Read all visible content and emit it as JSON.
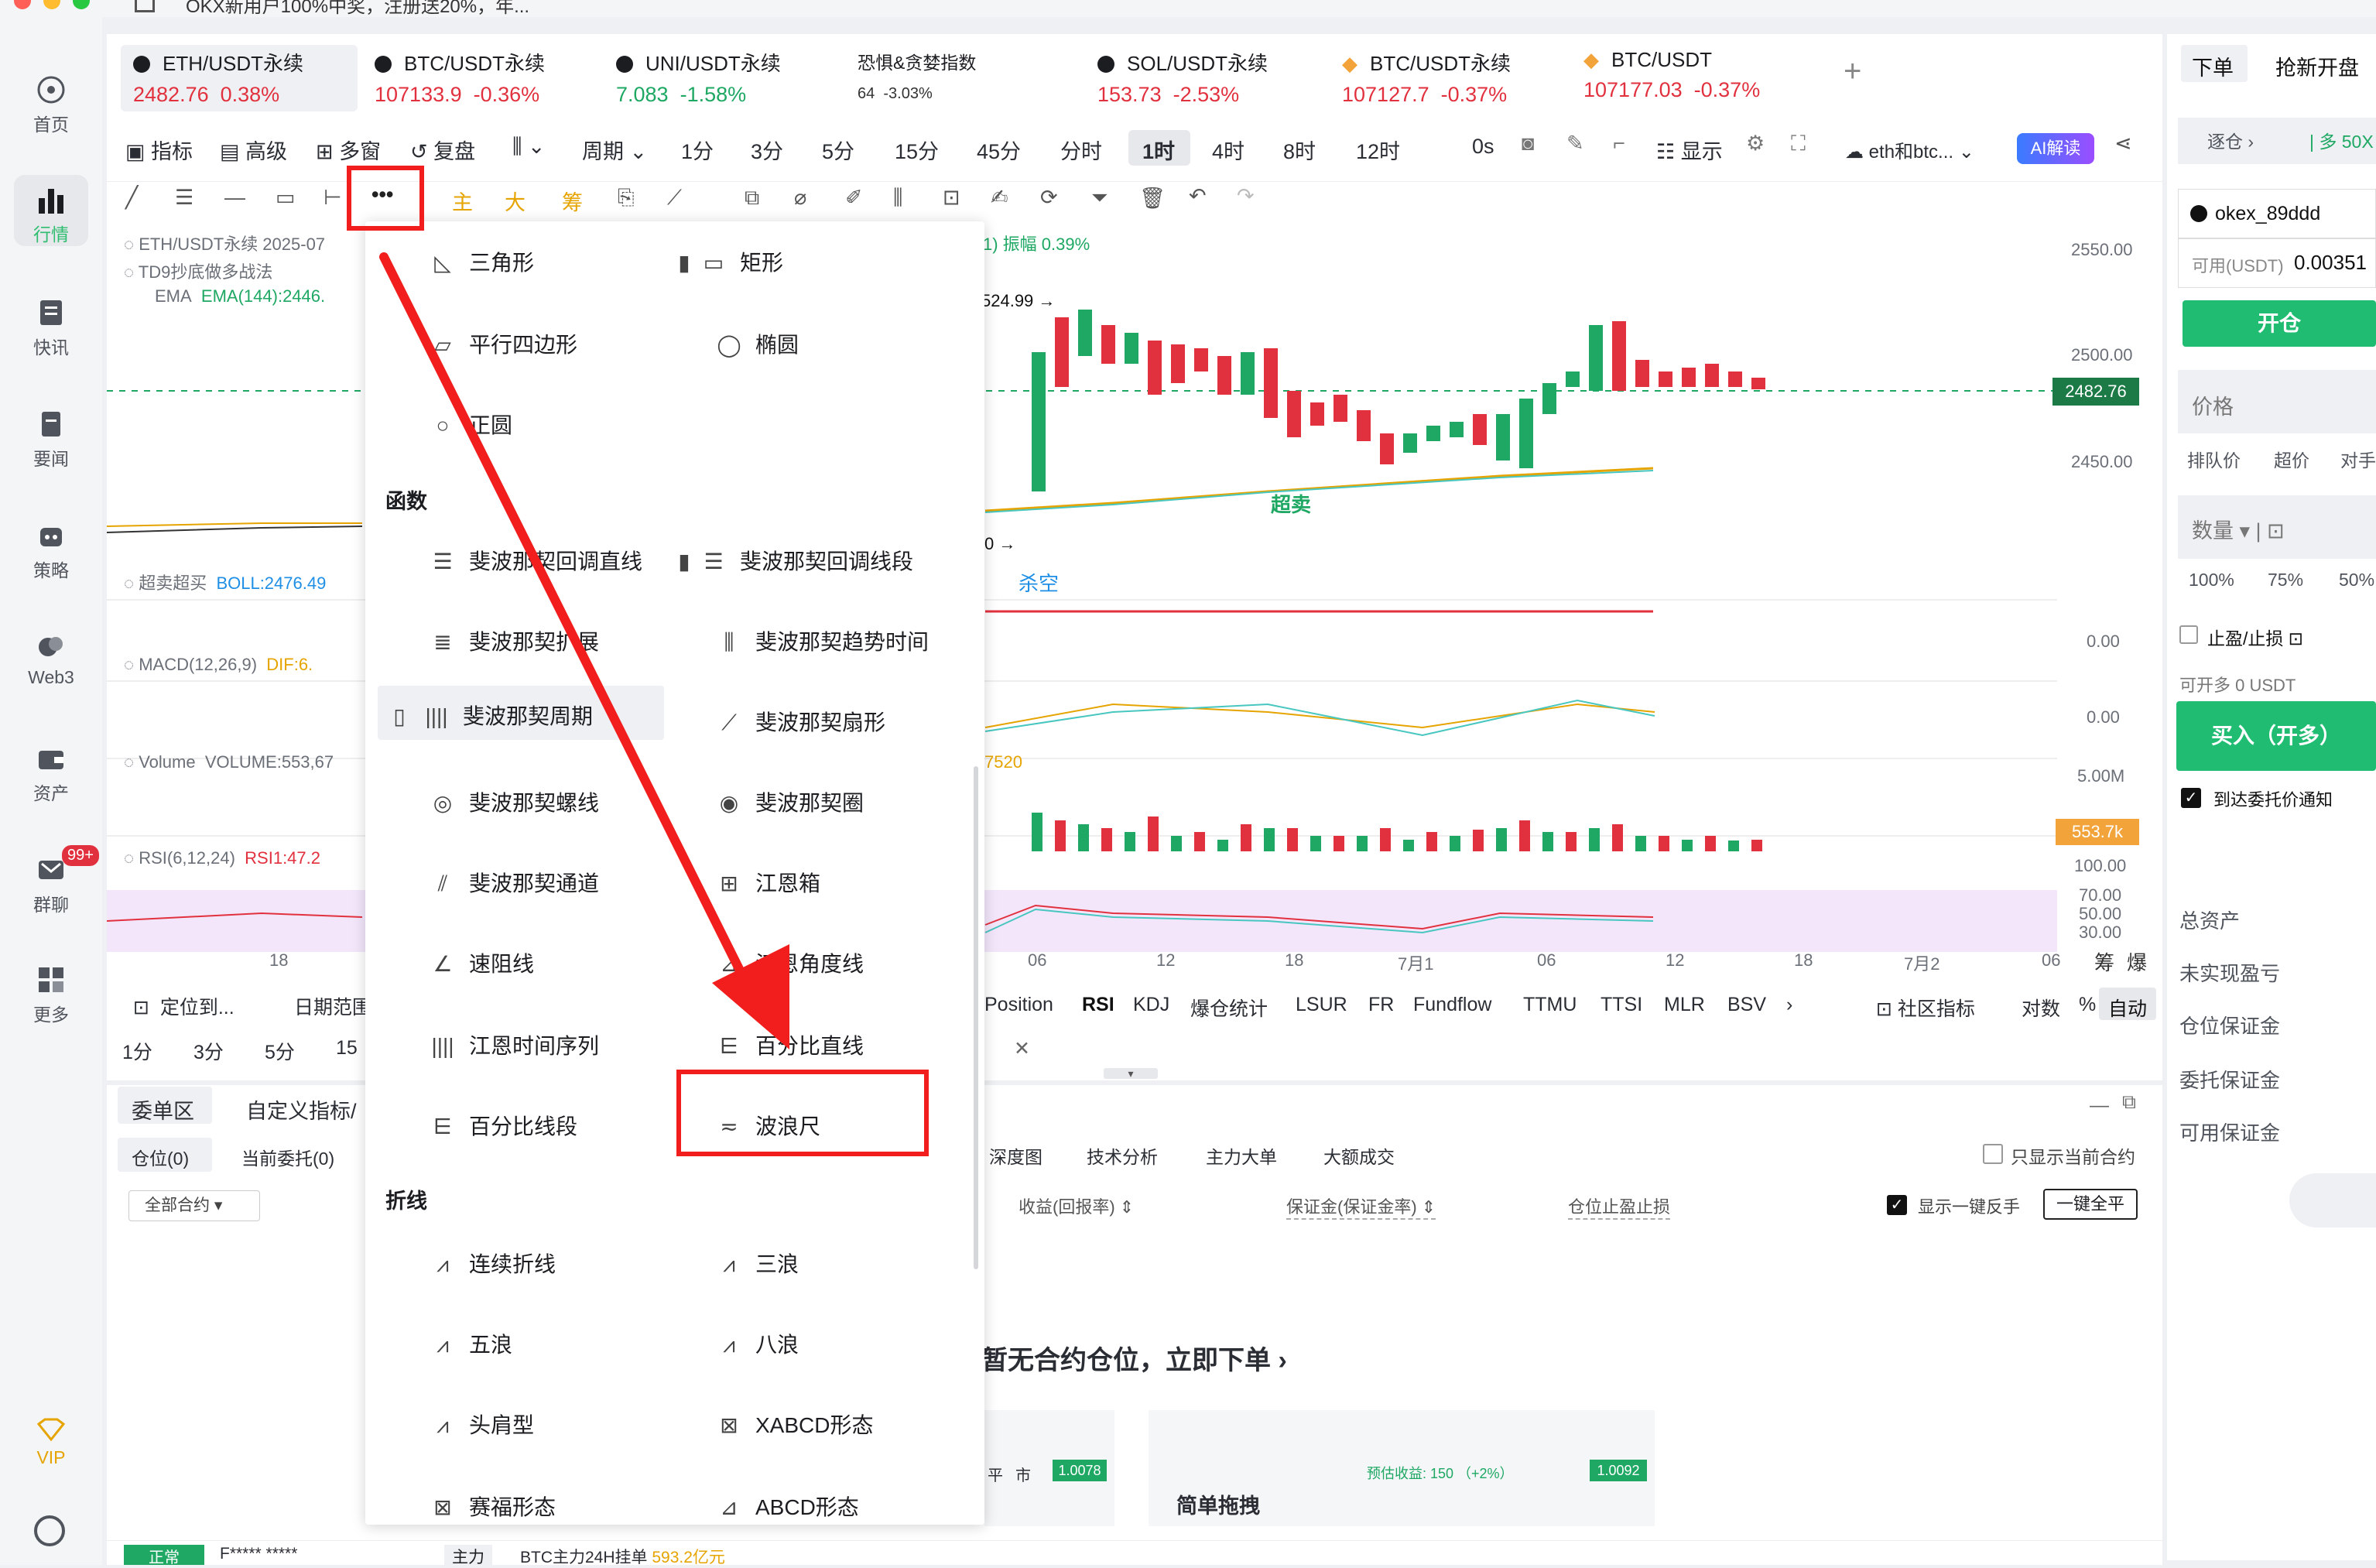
{
  "top_notice": "OKX新用户100%中奖，注册送20%，年...",
  "sidebar": [
    {
      "label": "首页"
    },
    {
      "label": "行情"
    },
    {
      "label": "快讯"
    },
    {
      "label": "要闻"
    },
    {
      "label": "策略"
    },
    {
      "label": "Web3"
    },
    {
      "label": "资产"
    },
    {
      "label": "群聊",
      "badge": "99+"
    },
    {
      "label": "更多"
    },
    {
      "label": "VIP"
    }
  ],
  "tabs": [
    {
      "name": "ETH/USDT永续",
      "price": "2482.76",
      "change": "0.38%"
    },
    {
      "name": "BTC/USDT永续",
      "price": "107133.9",
      "change": "-0.36%"
    },
    {
      "name": "UNI/USDT永续",
      "price": "7.083",
      "change": "-1.58%"
    },
    {
      "name": "恐惧&贪婪指数",
      "price": "64",
      "change": "-3.03%"
    },
    {
      "name": "SOL/USDT永续",
      "price": "153.73",
      "change": "-2.53%"
    },
    {
      "name": "BTC/USDT永续",
      "price": "107127.7",
      "change": "-0.37%"
    },
    {
      "name": "BTC/USDT",
      "price": "107177.03",
      "change": "-0.37%"
    }
  ],
  "toolbar1": [
    "指标",
    "高级",
    "多窗",
    "复盘",
    "周期",
    "1分",
    "3分",
    "5分",
    "15分",
    "45分",
    "分时",
    "1时",
    "4时",
    "8时",
    "12时",
    "0s",
    "显示",
    "eth和btc...",
    "AI解读"
  ],
  "toolbar2_colored": [
    "主",
    "大",
    "筹"
  ],
  "chart": {
    "symbol_line": "ETH/USDT永续  2025-07",
    "strategy": "TD9抄底做多战法",
    "ema": "EMA",
    "ema_val": "EMA(144):2446.",
    "amp": "1) 振幅 0.39%",
    "hi_label": "524.99",
    "lo_label": "0",
    "oversold": "超卖",
    "short": "杀空",
    "price_axis": [
      "2550.00",
      "2500.00",
      "2450.00"
    ],
    "current_price": "2482.76",
    "boll": "超卖超买",
    "boll_val": "BOLL:2476.49",
    "macd": "MACD(12,26,9)",
    "macd_val": "DIF:6.",
    "vol": "Volume",
    "vol_val": "VOLUME:553,67",
    "vol_right": "7520",
    "rsi": "RSI(6,12,24)",
    "rsi_val": "RSI1:47.2",
    "axis_r": [
      "0.00",
      "0.00",
      "5.00M",
      "553.7k",
      "100.00",
      "70.00",
      "50.00",
      "30.00"
    ],
    "time_axis": [
      "18",
      "06",
      "12",
      "18",
      "7月1",
      "06",
      "12",
      "18",
      "7月2",
      "06"
    ],
    "corner": [
      "筹",
      "爆"
    ]
  },
  "bottom_tabs": [
    "Position",
    "RSI",
    "KDJ",
    "爆仓统计",
    "LSUR",
    "FR",
    "Fundflow",
    "TTMU",
    "TTSI",
    "MLR",
    "BSV",
    "社区指标",
    "对数",
    "%",
    "自动"
  ],
  "left_under": [
    "定位到...",
    "日期范围",
    "1分",
    "3分",
    "5分",
    "15"
  ],
  "panel": {
    "tabs": [
      "委单区",
      "自定义指标/"
    ],
    "subtabs": [
      "仓位(0)",
      "当前委托(0)"
    ],
    "all": "全部合约",
    "cols": [
      "收益(回报率)",
      "保证金(保证金率)",
      "仓位止盈止损"
    ],
    "show_one": "显示一键反手",
    "close_all": "一键全平",
    "only_cur": "只显示当前合约",
    "ana": [
      "深度图",
      "技术分析",
      "主力大单",
      "大额成交"
    ],
    "empty": "暂无合约仓位，立即下单",
    "promo_a": [
      "平",
      "市",
      "1.0078"
    ],
    "promo_b": [
      "简单拖拽",
      "预估收益: 150 （+2%）",
      "1.0092"
    ]
  },
  "status": {
    "state": "正常",
    "acct": "F*****  *****",
    "main": "主力",
    "line": "BTC主力24H挂单",
    "amt": "593.2亿元"
  },
  "menu": {
    "shapes": [
      {
        "i": "◺",
        "t": "三角形"
      },
      {
        "i": "▭",
        "t": "矩形"
      },
      {
        "i": "▱",
        "t": "平行四边形"
      },
      {
        "i": "◯",
        "t": "椭圆"
      },
      {
        "i": "○",
        "t": "正圆"
      }
    ],
    "h_func": "函数",
    "func": [
      {
        "i": "☰",
        "t": "斐波那契回调直线"
      },
      {
        "i": "☰",
        "t": "斐波那契回调线段"
      },
      {
        "i": "≣",
        "t": "斐波那契扩展"
      },
      {
        "i": "⫼",
        "t": "斐波那契趋势时间"
      },
      {
        "i": "||||",
        "t": "斐波那契周期"
      },
      {
        "i": "⟋",
        "t": "斐波那契扇形"
      },
      {
        "i": "◎",
        "t": "斐波那契螺线"
      },
      {
        "i": "◉",
        "t": "斐波那契圈"
      },
      {
        "i": "⫽",
        "t": "斐波那契通道"
      },
      {
        "i": "⊞",
        "t": "江恩箱"
      },
      {
        "i": "∠",
        "t": "速阻线"
      },
      {
        "i": "⊿",
        "t": "江恩角度线"
      },
      {
        "i": "||||",
        "t": "江恩时间序列"
      },
      {
        "i": "⋿",
        "t": "百分比直线"
      },
      {
        "i": "⋿",
        "t": "百分比线段"
      },
      {
        "i": "≂",
        "t": "波浪尺"
      }
    ],
    "h_line": "折线",
    "line": [
      {
        "i": "⩘",
        "t": "连续折线"
      },
      {
        "i": "⩘",
        "t": "三浪"
      },
      {
        "i": "⩘",
        "t": "五浪"
      },
      {
        "i": "⩘",
        "t": "八浪"
      },
      {
        "i": "⩘",
        "t": "头肩型"
      },
      {
        "i": "⊠",
        "t": "XABCD形态"
      },
      {
        "i": "⊠",
        "t": "赛福形态"
      },
      {
        "i": "⊿",
        "t": "ABCD形态"
      }
    ]
  },
  "right": {
    "tabs": [
      "下单",
      "抢新开盘"
    ],
    "mode": "逐仓",
    "lev": "多 50X",
    "acct": "okex_89ddd",
    "avail_l": "可用(USDT)",
    "avail_v": "0.00351",
    "open": "开仓",
    "price": "价格",
    "sub": [
      "排队价",
      "超价",
      "对手"
    ],
    "qty": "数量",
    "pcts": [
      "100%",
      "75%",
      "50%"
    ],
    "tpsl": "止盈/止损",
    "canopen": "可开多 0 USDT",
    "buy": "买入（开多）",
    "notify": "到达委托价通知",
    "list": [
      "总资产",
      "未实现盈亏",
      "仓位保证金",
      "委托保证金",
      "可用保证金"
    ]
  },
  "colors": {
    "up": "#1ea863",
    "down": "#e2313e",
    "accent": "#f21d1d",
    "brand": "#1fbc71"
  }
}
